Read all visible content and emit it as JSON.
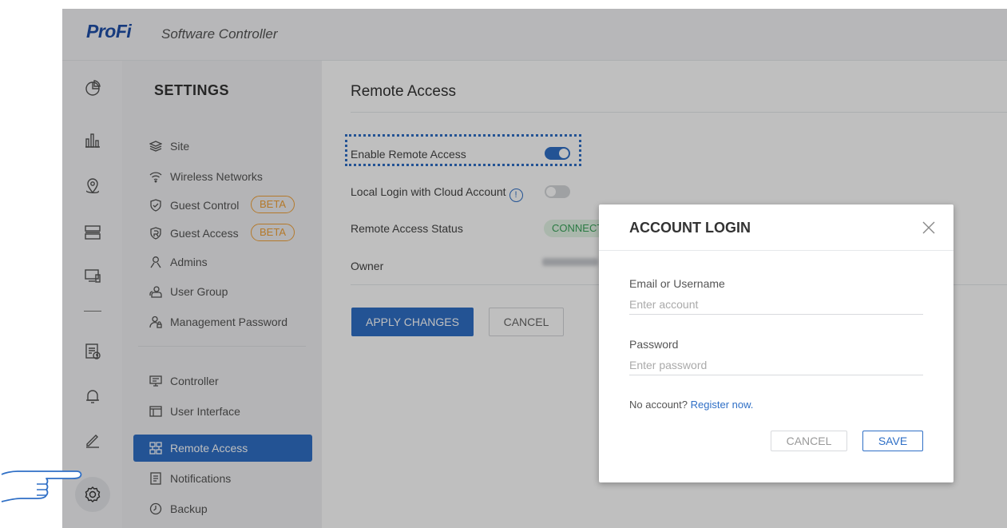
{
  "brand": {
    "logo": "ProFi",
    "subtitle": "Software Controller"
  },
  "icon_rail": {
    "icons": [
      "dashboard-icon",
      "statistics-icon",
      "map-icon",
      "devices-icon",
      "clients-icon",
      "logs-icon",
      "alerts-icon",
      "edit-icon",
      "settings-gear-icon"
    ],
    "active": "settings-gear-icon"
  },
  "settings": {
    "title": "SETTINGS",
    "items": [
      {
        "label": "Site",
        "icon": "layers-icon"
      },
      {
        "label": "Wireless Networks",
        "icon": "wifi-icon"
      },
      {
        "label": "Guest Control",
        "icon": "shield-check-icon",
        "badge": "BETA"
      },
      {
        "label": "Guest Access",
        "icon": "guest-access-icon",
        "badge": "BETA"
      },
      {
        "label": "Admins",
        "icon": "admin-user-icon"
      },
      {
        "label": "User Group",
        "icon": "user-group-icon"
      },
      {
        "label": "Management Password",
        "icon": "user-lock-icon"
      },
      {
        "label": "Controller",
        "icon": "controller-icon"
      },
      {
        "label": "User Interface",
        "icon": "layout-icon"
      },
      {
        "label": "Remote Access",
        "icon": "remote-access-icon",
        "active": true
      },
      {
        "label": "Notifications",
        "icon": "notification-doc-icon"
      },
      {
        "label": "Backup",
        "icon": "backup-icon"
      }
    ]
  },
  "main": {
    "title": "Remote Access",
    "enable_remote_access": {
      "label": "Enable Remote Access",
      "on": true
    },
    "local_login": {
      "label": "Local Login with Cloud Account",
      "on": false
    },
    "status": {
      "label": "Remote Access Status",
      "value": "CONNECTED"
    },
    "owner": {
      "label": "Owner"
    },
    "apply_label": "APPLY CHANGES",
    "cancel_label": "CANCEL"
  },
  "modal": {
    "title": "ACCOUNT LOGIN",
    "email": {
      "label": "Email or Username",
      "placeholder": "Enter account"
    },
    "password": {
      "label": "Password",
      "placeholder": "Enter password"
    },
    "no_account_text": "No account?",
    "register_link": "Register now.",
    "cancel_label": "CANCEL",
    "save_label": "SAVE"
  },
  "colors": {
    "accent": "#2f6fc6",
    "beta": "#f0a23a",
    "status_green": "#3aa35a"
  }
}
